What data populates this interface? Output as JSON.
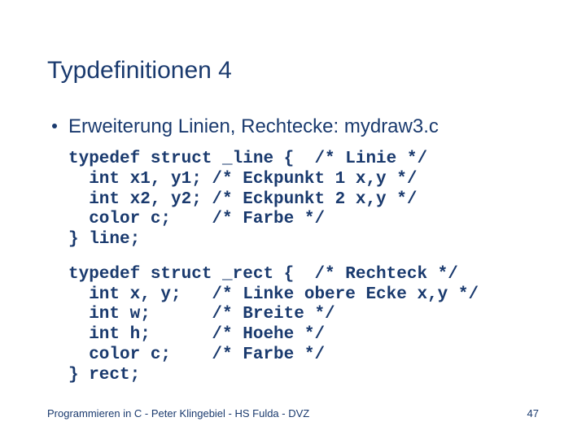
{
  "title": "Typdefinitionen 4",
  "bullet": "Erweiterung Linien, Rechtecke: mydraw3.c",
  "code1": "typedef struct _line {  /* Linie */\n  int x1, y1; /* Eckpunkt 1 x,y */\n  int x2, y2; /* Eckpunkt 2 x,y */\n  color c;    /* Farbe */\n} line;",
  "code2": "typedef struct _rect {  /* Rechteck */\n  int x, y;   /* Linke obere Ecke x,y */\n  int w;      /* Breite */\n  int h;      /* Hoehe */\n  color c;    /* Farbe */\n} rect;",
  "footer_left": "Programmieren in C - Peter Klingebiel - HS Fulda - DVZ",
  "footer_right": "47"
}
